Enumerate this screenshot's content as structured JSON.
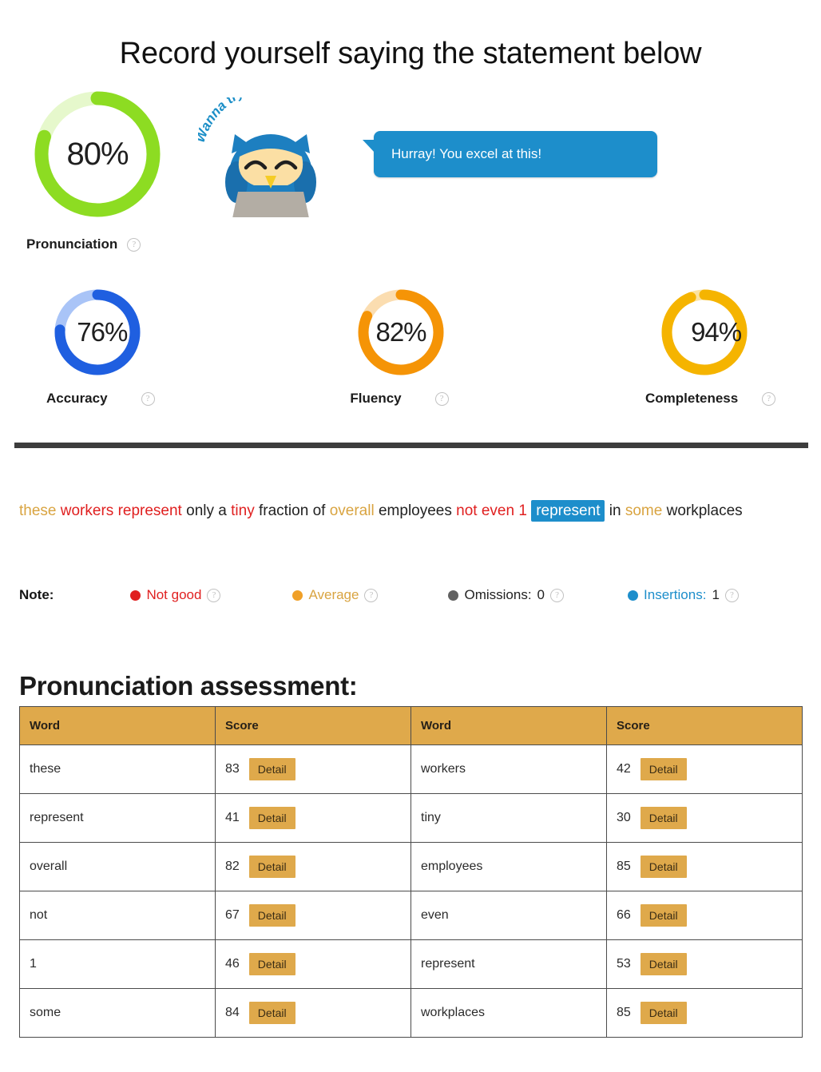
{
  "page": {
    "title": "Record yourself saying the statement below",
    "section_heading": "Pronunciation assessment:"
  },
  "mascot": {
    "arc_text": "Wanna try again?",
    "bubble_text": "Hurray! You excel at this!",
    "bubble_color": "#1d8ecb"
  },
  "scores": {
    "pronunciation": {
      "label": "Pronunciation",
      "value": 80,
      "display": "80%",
      "color": "#8ddc22",
      "track": "#e6f8cc",
      "help": "?"
    },
    "accuracy": {
      "label": "Accuracy",
      "value": 76,
      "display": "76%",
      "color": "#1f5fe0",
      "track": "#a9c4f7",
      "help": "?"
    },
    "fluency": {
      "label": "Fluency",
      "value": 82,
      "display": "82%",
      "color": "#f59406",
      "track": "#fbddb0",
      "help": "?"
    },
    "completeness": {
      "label": "Completeness",
      "value": 94,
      "display": "94%",
      "color": "#f5b400",
      "track": "#fbe2a0",
      "help": "?"
    }
  },
  "transcript": {
    "words": [
      {
        "text": "these",
        "state": "avg"
      },
      {
        "text": "workers",
        "state": "bad"
      },
      {
        "text": "represent",
        "state": "bad"
      },
      {
        "text": "only",
        "state": "good"
      },
      {
        "text": "a",
        "state": "good"
      },
      {
        "text": "tiny",
        "state": "bad"
      },
      {
        "text": "fraction",
        "state": "good"
      },
      {
        "text": "of",
        "state": "good"
      },
      {
        "text": "overall",
        "state": "avg"
      },
      {
        "text": "employees",
        "state": "good"
      },
      {
        "text": "not",
        "state": "bad"
      },
      {
        "text": "even",
        "state": "bad"
      },
      {
        "text": "1",
        "state": "bad"
      },
      {
        "text": "represent",
        "state": "ins"
      },
      {
        "text": "in",
        "state": "good"
      },
      {
        "text": "some",
        "state": "avg"
      },
      {
        "text": "workplaces",
        "state": "good"
      }
    ]
  },
  "note": {
    "label": "Note:",
    "legend": [
      {
        "name": "not-good",
        "text": "Not good",
        "count": "",
        "color": "#e02020",
        "text_color": "#e02020",
        "help": "?"
      },
      {
        "name": "average",
        "text": "Average",
        "count": "",
        "color": "#f0a028",
        "text_color": "#d9a441",
        "help": "?"
      },
      {
        "name": "omissions",
        "text": "Omissions:",
        "count": "0",
        "color": "#616161",
        "text_color": "#222222",
        "help": "?"
      },
      {
        "name": "insertions",
        "text": "Insertions:",
        "count": "1",
        "color": "#1d8ecb",
        "text_color": "#1d8ecb",
        "help": "?"
      }
    ]
  },
  "table": {
    "headers": [
      "Word",
      "Score",
      "Word",
      "Score"
    ],
    "detail_label": "Detail",
    "rows": [
      {
        "word_a": "these",
        "score_a": "83",
        "word_b": "workers",
        "score_b": "42"
      },
      {
        "word_a": "represent",
        "score_a": "41",
        "word_b": "tiny",
        "score_b": "30"
      },
      {
        "word_a": "overall",
        "score_a": "82",
        "word_b": "employees",
        "score_b": "85"
      },
      {
        "word_a": "not",
        "score_a": "67",
        "word_b": "even",
        "score_b": "66"
      },
      {
        "word_a": "1",
        "score_a": "46",
        "word_b": "represent",
        "score_b": "53"
      },
      {
        "word_a": "some",
        "score_a": "84",
        "word_b": "workplaces",
        "score_b": "85"
      }
    ]
  }
}
